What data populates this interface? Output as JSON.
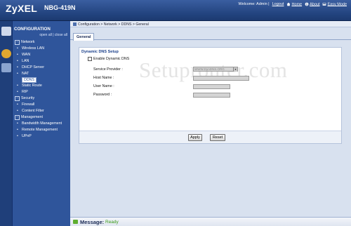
{
  "header": {
    "brand": "ZyXEL",
    "model": "NBG-419N",
    "welcome": "Welcome: Admin |",
    "logout": "Logout",
    "home": "Home",
    "about": "About",
    "easy_mode": "Easy Mode"
  },
  "sidebar": {
    "title": "CONFIGURATION",
    "open_all": "open all",
    "separator": "|",
    "close_all": "close all",
    "groups": [
      {
        "label": "Network",
        "items": [
          "Wireless LAN",
          "WAN",
          "LAN",
          "DHCP Server",
          "NAT",
          "DDNS",
          "Static Route",
          "RIP"
        ]
      },
      {
        "label": "Security",
        "items": [
          "Firewall",
          "Content Filter"
        ]
      },
      {
        "label": "Management",
        "items": [
          "Bandwidth Management",
          "Remote Management",
          "UPnP"
        ]
      }
    ],
    "selected": "DDNS"
  },
  "breadcrumb": "Configuration > Network > DDNS > General",
  "tabs": [
    {
      "label": "General",
      "active": true
    }
  ],
  "form": {
    "section_title": "Dynamic DNS Setup",
    "enable_label": "Enable Dynamic DNS",
    "enabled": false,
    "service_provider_label": "Service Provider :",
    "service_provider_value": "WWW.DynDNS.ORG",
    "host_name_label": "Host Name :",
    "host_name_value": "",
    "user_name_label": "User Name :",
    "user_name_value": "",
    "password_label": "Password :",
    "password_value": ""
  },
  "buttons": {
    "apply": "Apply",
    "reset": "Reset"
  },
  "watermark": "Setuprouter.com",
  "message": {
    "title": "Message:",
    "status": "Ready"
  },
  "colors": {
    "accent": "#2f559b",
    "status_ok": "#3a9a1a"
  },
  "icons": [
    "home-icon",
    "about-icon",
    "easy-mode-icon",
    "message-icon"
  ]
}
